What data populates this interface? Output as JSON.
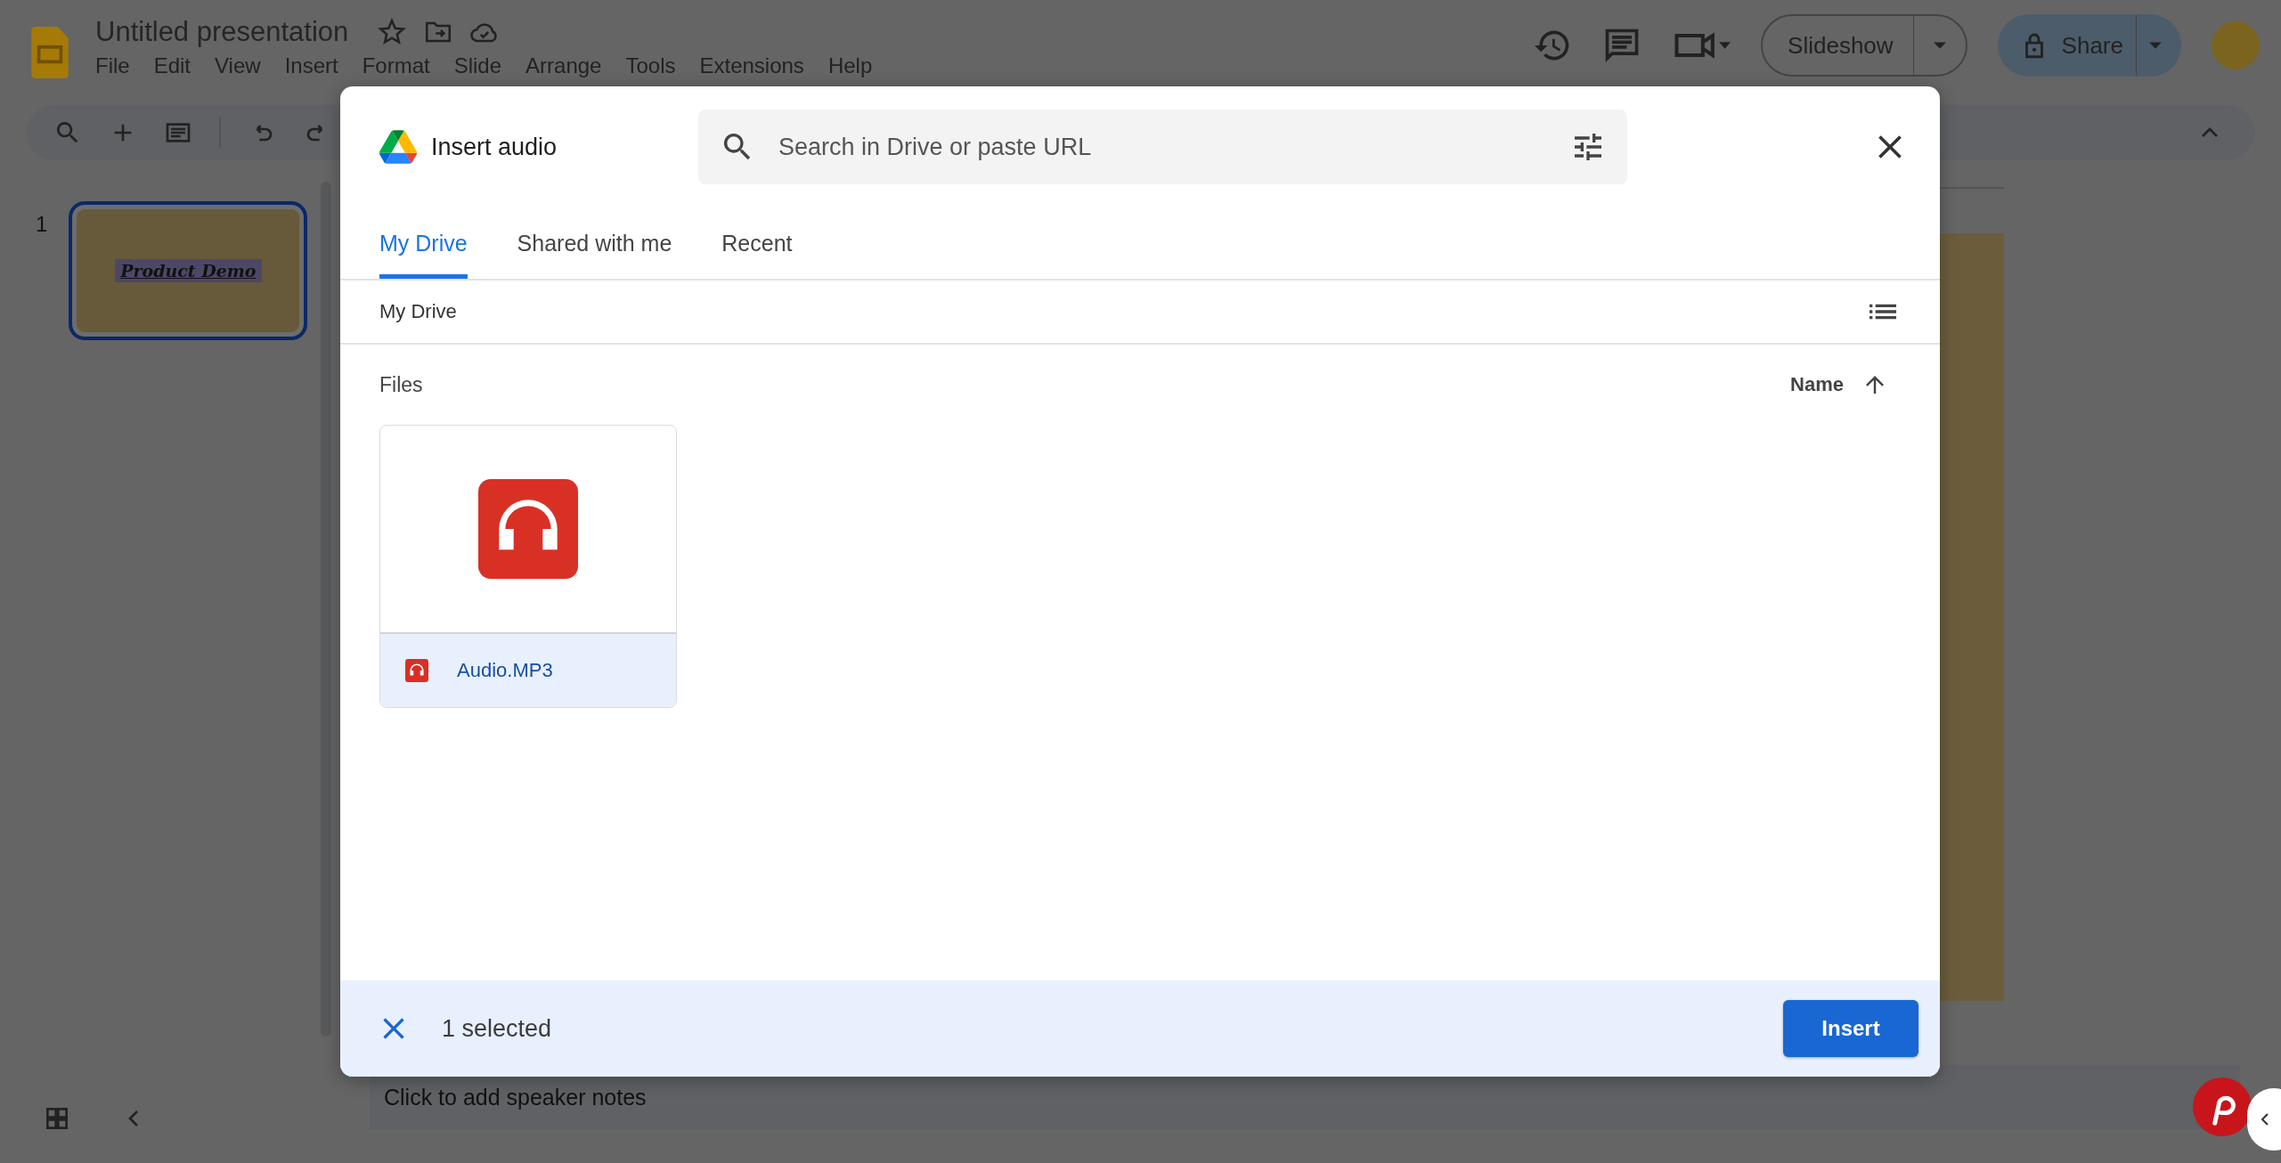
{
  "app": {
    "title": "Untitled presentation",
    "menu": [
      "File",
      "Edit",
      "View",
      "Insert",
      "Format",
      "Slide",
      "Arrange",
      "Tools",
      "Extensions",
      "Help"
    ],
    "slideshow_button": "Slideshow",
    "share_button": "Share"
  },
  "filmstrip": {
    "slides": [
      {
        "number": "1",
        "title": "Product Demo",
        "selected": true
      }
    ]
  },
  "speaker_notes": {
    "placeholder": "Click to add speaker notes"
  },
  "dialog": {
    "title": "Insert audio",
    "search": {
      "placeholder": "Search in Drive or paste URL"
    },
    "tabs": [
      {
        "label": "My Drive",
        "selected": true
      },
      {
        "label": "Shared with me",
        "selected": false
      },
      {
        "label": "Recent",
        "selected": false
      }
    ],
    "breadcrumb": "My Drive",
    "section": "Files",
    "sort": {
      "label": "Name"
    },
    "files": [
      {
        "name": "Audio.MP3",
        "selected": true
      }
    ],
    "footer": {
      "status": "1 selected",
      "button": "Insert"
    }
  }
}
